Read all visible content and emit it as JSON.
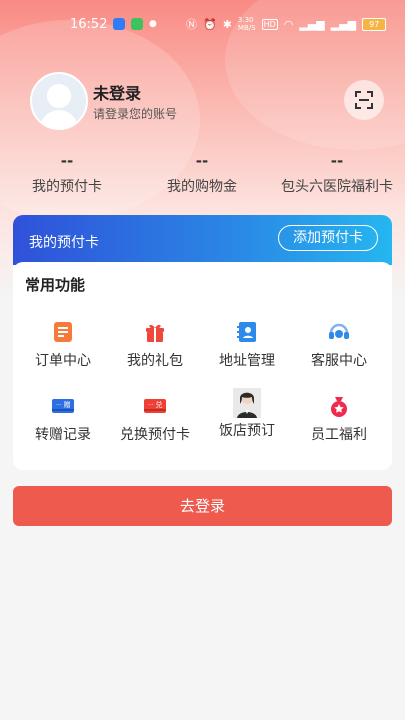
{
  "status_bar": {
    "time": "16:52",
    "network_speed_top": "3.30",
    "network_speed_bottom": "MB/S",
    "hd": "HD",
    "battery": "97"
  },
  "profile": {
    "name": "未登录",
    "subtitle": "请登录您的账号"
  },
  "stats": [
    {
      "value": "--",
      "label": "我的预付卡"
    },
    {
      "value": "--",
      "label": "我的购物金"
    },
    {
      "value": "--",
      "label": "包头六医院福利卡"
    }
  ],
  "prepaid_card": {
    "title": "我的预付卡",
    "add_label": "添加预付卡"
  },
  "functions": {
    "title": "常用功能",
    "items": [
      {
        "label": "订单中心",
        "icon": "order-icon"
      },
      {
        "label": "我的礼包",
        "icon": "gift-icon"
      },
      {
        "label": "地址管理",
        "icon": "address-book-icon"
      },
      {
        "label": "客服中心",
        "icon": "headset-icon"
      },
      {
        "label": "转赠记录",
        "icon": "gift-card-icon",
        "badge": "赠"
      },
      {
        "label": "兑换预付卡",
        "icon": "exchange-card-icon",
        "badge": "兑"
      },
      {
        "label": "饭店预订",
        "icon": "receptionist-icon"
      },
      {
        "label": "员工福利",
        "icon": "welfare-bag-icon"
      }
    ]
  },
  "login_button": "去登录",
  "colors": {
    "accent": "#ef5a4e",
    "card_gradient_start": "#2f51d9",
    "card_gradient_end": "#25b6f0"
  }
}
